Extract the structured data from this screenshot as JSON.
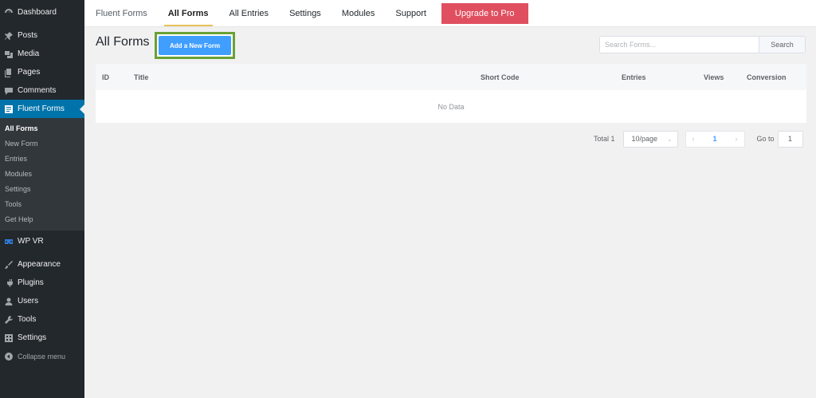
{
  "sidebar": {
    "top_items": [
      {
        "label": "Dashboard",
        "icon": "dashboard-icon"
      },
      {
        "label": "Posts",
        "icon": "pin-icon"
      },
      {
        "label": "Media",
        "icon": "media-icon"
      },
      {
        "label": "Pages",
        "icon": "pages-icon"
      },
      {
        "label": "Comments",
        "icon": "comment-icon"
      }
    ],
    "active_item": {
      "label": "Fluent Forms",
      "icon": "fluent-forms-icon"
    },
    "submenu": [
      "All Forms",
      "New Form",
      "Entries",
      "Modules",
      "Settings",
      "Tools",
      "Get Help"
    ],
    "wpvr": {
      "label": "WP VR",
      "icon": "vr-icon"
    },
    "bottom_items": [
      {
        "label": "Appearance",
        "icon": "brush-icon"
      },
      {
        "label": "Plugins",
        "icon": "plugin-icon"
      },
      {
        "label": "Users",
        "icon": "user-icon"
      },
      {
        "label": "Tools",
        "icon": "wrench-icon"
      },
      {
        "label": "Settings",
        "icon": "settings-icon"
      }
    ],
    "collapse_label": "Collapse menu"
  },
  "topnav": {
    "brand": "Fluent Forms",
    "items": [
      "All Forms",
      "All Entries",
      "Settings",
      "Modules",
      "Support"
    ],
    "active": "All Forms",
    "upgrade_label": "Upgrade to Pro"
  },
  "header": {
    "title": "All Forms",
    "add_button": "Add a New Form",
    "search_placeholder": "Search Forms...",
    "search_button": "Search"
  },
  "table": {
    "columns": [
      "ID",
      "Title",
      "Short Code",
      "Entries",
      "Views",
      "Conversion"
    ],
    "empty_text": "No Data"
  },
  "pagination": {
    "total": "Total 1",
    "page_size": "10/page",
    "current_page": "1",
    "goto_label": "Go to",
    "goto_value": "1"
  },
  "colors": {
    "sidebar_bg": "#23282d",
    "active_menu": "#0073aa",
    "upgrade": "#e04f5f",
    "primary_button": "#409eff",
    "highlight_border": "#6aa135"
  }
}
